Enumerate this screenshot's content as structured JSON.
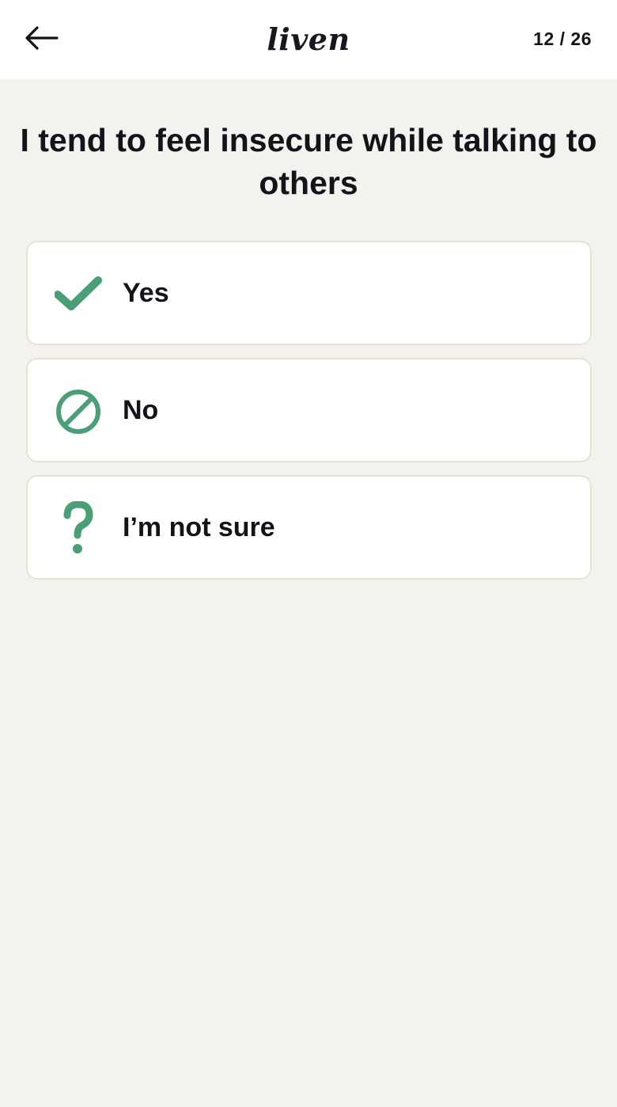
{
  "header": {
    "logo_text": "liven",
    "progress": "12 / 26"
  },
  "question": {
    "text": "I tend to feel insecure while talking to others"
  },
  "options": [
    {
      "label": "Yes",
      "icon": "checkmark-icon"
    },
    {
      "label": "No",
      "icon": "prohibited-icon"
    },
    {
      "label": "I’m not sure",
      "icon": "question-mark-icon"
    }
  ],
  "colors": {
    "accent": "#4a9f76",
    "background": "#f4f2ee",
    "card_border": "#e6e2d6"
  }
}
